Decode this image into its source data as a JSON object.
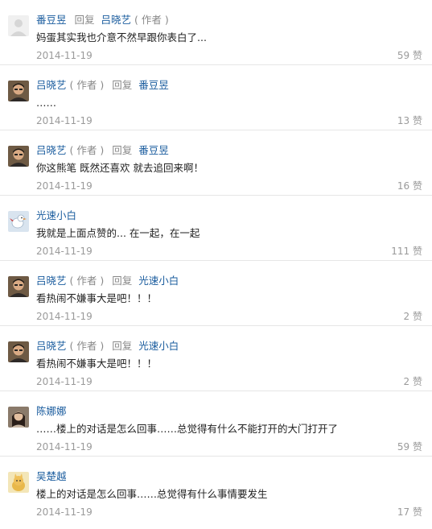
{
  "comments": [
    {
      "avatar": "blank-avatar",
      "name": "番豆昱",
      "name_tag": "",
      "reply_label": "回复",
      "target": "吕晓艺",
      "target_tag": "( 作者 )",
      "content": "妈蛋其实我也介意不然早跟你表白了...",
      "date": "2014-11-19",
      "likes": "59 赞"
    },
    {
      "avatar": "man-avatar",
      "name": "吕晓艺",
      "name_tag": "( 作者 )",
      "reply_label": "回复",
      "target": "番豆昱",
      "target_tag": "",
      "content": "……",
      "date": "2014-11-19",
      "likes": "13 赞"
    },
    {
      "avatar": "man-avatar",
      "name": "吕晓艺",
      "name_tag": "( 作者 )",
      "reply_label": "回复",
      "target": "番豆昱",
      "target_tag": "",
      "content": "你这熊笔 既然还喜欢 就去追回来啊！",
      "date": "2014-11-19",
      "likes": "16 赞"
    },
    {
      "avatar": "bird-avatar",
      "name": "光速小白",
      "name_tag": "",
      "reply_label": "",
      "target": "",
      "target_tag": "",
      "content": "我就是上面点赞的... 在一起，在一起",
      "date": "2014-11-19",
      "likes": "111 赞"
    },
    {
      "avatar": "man-avatar",
      "name": "吕晓艺",
      "name_tag": "( 作者 )",
      "reply_label": "回复",
      "target": "光速小白",
      "target_tag": "",
      "content": "看热闹不嫌事大是吧！！！",
      "date": "2014-11-19",
      "likes": "2 赞"
    },
    {
      "avatar": "man-avatar",
      "name": "吕晓艺",
      "name_tag": "( 作者 )",
      "reply_label": "回复",
      "target": "光速小白",
      "target_tag": "",
      "content": "看热闹不嫌事大是吧！！！",
      "date": "2014-11-19",
      "likes": "2 赞"
    },
    {
      "avatar": "woman-avatar",
      "name": "陈娜娜",
      "name_tag": "",
      "reply_label": "",
      "target": "",
      "target_tag": "",
      "content": "……楼上的对话是怎么回事……总觉得有什么不能打开的大门打开了",
      "date": "2014-11-19",
      "likes": "59 赞"
    },
    {
      "avatar": "cat-avatar",
      "name": "吴楚越",
      "name_tag": "",
      "reply_label": "",
      "target": "",
      "target_tag": "",
      "content": "楼上的对话是怎么回事……总觉得有什么事情要发生",
      "date": "2014-11-19",
      "likes": "17 赞"
    }
  ]
}
